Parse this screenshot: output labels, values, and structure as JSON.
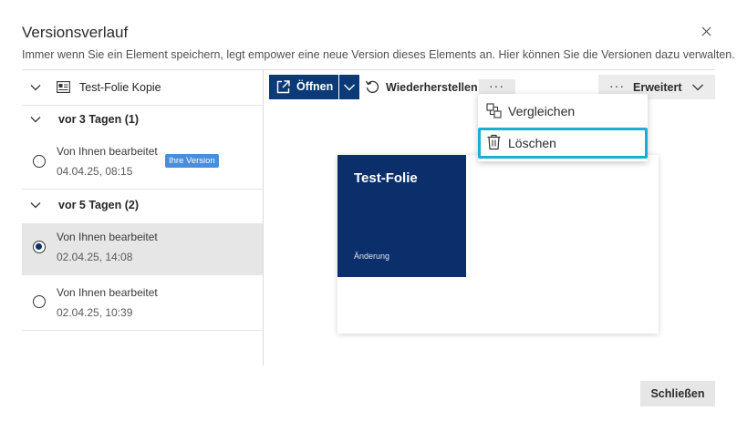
{
  "dialog": {
    "title": "Versionsverlauf",
    "subtitle": "Immer wenn Sie ein Element speichern, legt empower eine neue Version dieses Elements an. Hier können Sie die Versionen dazu verwalten."
  },
  "document": {
    "name": "Test-Folie Kopie"
  },
  "groups": [
    {
      "label": "vor 3 Tagen (1)",
      "versions": [
        {
          "author": "Von Ihnen bearbeitet",
          "date": "04.04.25, 08:15",
          "badge": "Ihre Version"
        }
      ]
    },
    {
      "label": "vor 5 Tagen (2)",
      "versions": [
        {
          "author": "Von Ihnen bearbeitet",
          "date": "02.04.25, 14:08"
        },
        {
          "author": "Von Ihnen bearbeitet",
          "date": "02.04.25, 10:39"
        }
      ]
    }
  ],
  "toolbar": {
    "open_label": "Öffnen",
    "restore_label": "Wiederherstellen",
    "more_label": "···",
    "advanced_more": "···",
    "advanced_label": "Erweitert"
  },
  "menu": {
    "compare_label": "Vergleichen",
    "delete_label": "Löschen"
  },
  "preview": {
    "slide_title": "Test-Folie",
    "slide_subtitle": "Änderung"
  },
  "footer": {
    "close_label": "Schließen"
  },
  "colors": {
    "accent": "#0b3a78",
    "focus": "#1aaecf",
    "badge": "#4a8ddb",
    "selected_row": "#e6e6e6"
  }
}
